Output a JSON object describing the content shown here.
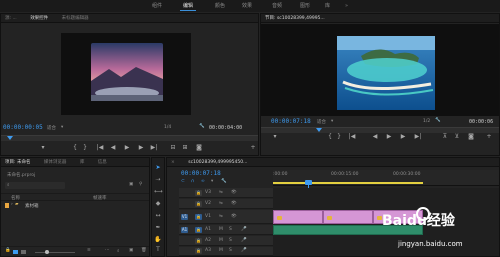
{
  "workspace": {
    "tabs": [
      "组件",
      "编辑",
      "颜色",
      "效果",
      "音频",
      "图形",
      "库"
    ],
    "active_index": 1
  },
  "source_panel": {
    "tabs": [
      "源: ...",
      "效果控件",
      "未标题编辑器"
    ],
    "timecode": "00:00:00:05",
    "fit_label": "适合",
    "ratio": "1/4",
    "duration": "00:00:04:00"
  },
  "program_panel": {
    "title": "节目: sc10028399,49995...",
    "timecode": "00:00:07:18",
    "fit_label": "适合",
    "ratio": "1/2",
    "duration": "00:00:06"
  },
  "project_panel": {
    "tabs": [
      "项目: 未命名",
      "媒体浏览器",
      "库",
      "信息"
    ],
    "subfile": "未命名.prproj",
    "col_name": "名称",
    "col_rate": "帧速率",
    "bin_name": "素材箱"
  },
  "timeline": {
    "title": "sc10028399,499995450...",
    "timecode": "00:00:07:18",
    "ruler": [
      ":00:00",
      "00:00:15:00",
      "00:00:30:00"
    ],
    "tracks": [
      "V3",
      "V2",
      "V1",
      "A1",
      "A2",
      "A3"
    ]
  },
  "controls": {
    "play": "▶",
    "prev": "|◀",
    "next": "▶|",
    "mark_in": "{",
    "mark_out": "}"
  },
  "watermark": {
    "site": "jingyan.baidu.com",
    "brand": "Baidu经验"
  }
}
